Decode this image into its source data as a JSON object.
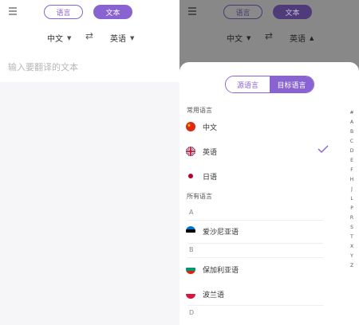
{
  "header": {
    "mode_voice": "语言",
    "mode_text": "文本",
    "source_lang": "中文",
    "target_lang": "英语"
  },
  "input": {
    "placeholder": "输入要翻译的文本"
  },
  "picker": {
    "tab_source": "源语言",
    "tab_target": "目标语言",
    "common_title": "常用语言",
    "common": [
      {
        "label": "中文",
        "flag": "china-flag-icon"
      },
      {
        "label": "英语",
        "flag": "uk-flag-icon",
        "selected": true
      },
      {
        "label": "日语",
        "flag": "japan-flag-icon"
      }
    ],
    "all_title": "所有语言",
    "groups": [
      {
        "letter": "A",
        "items": [
          {
            "label": "爱沙尼亚语",
            "flag": "estonia-flag-icon"
          }
        ]
      },
      {
        "letter": "B",
        "items": [
          {
            "label": "保加利亚语",
            "flag": "bulgaria-flag-icon"
          },
          {
            "label": "波兰语",
            "flag": "poland-flag-icon"
          }
        ]
      },
      {
        "letter": "D",
        "items": []
      }
    ],
    "index_letters": [
      "#",
      "A",
      "B",
      "C",
      "D",
      "E",
      "F",
      "H",
      "J",
      "L",
      "P",
      "R",
      "S",
      "T",
      "X",
      "Y",
      "Z"
    ]
  },
  "colors": {
    "accent": "#8a63d2"
  }
}
